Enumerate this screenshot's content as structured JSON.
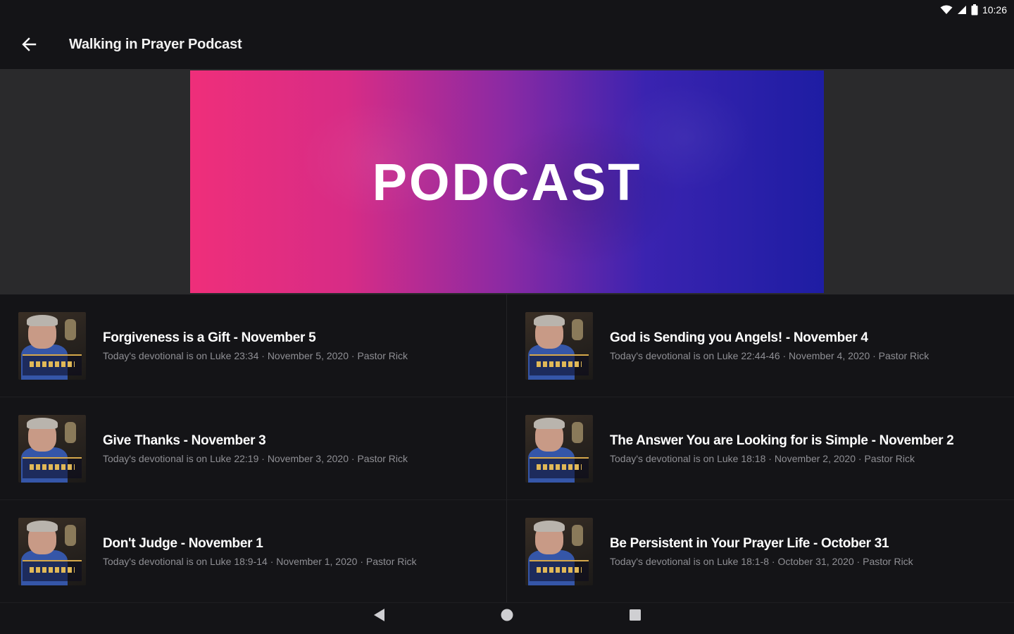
{
  "status_bar": {
    "time": "10:26",
    "icons": [
      "wifi-icon",
      "signal-icon",
      "battery-icon"
    ]
  },
  "app_bar": {
    "title": "Walking in Prayer Podcast",
    "back_icon": "arrow-left-icon"
  },
  "hero": {
    "text": "PODCAST",
    "colors": [
      "#ef2e7a",
      "#8a2aa4",
      "#1e1da3"
    ]
  },
  "episodes": [
    {
      "title": "Forgiveness is a Gift - November 5",
      "subtitle": "Today's devotional is on Luke 23:34 · November 5, 2020 · Pastor Rick"
    },
    {
      "title": "God is Sending you Angels! - November 4",
      "subtitle": "Today's devotional is on Luke 22:44-46 · November 4, 2020 · Pastor Rick"
    },
    {
      "title": "Give Thanks - November 3",
      "subtitle": "Today's devotional is on Luke 22:19 · November 3, 2020 · Pastor Rick"
    },
    {
      "title": "The Answer You are Looking for is Simple - November 2",
      "subtitle": "Today's devotional is on Luke 18:18 · November 2, 2020 · Pastor Rick"
    },
    {
      "title": "Don't Judge - November 1",
      "subtitle": "Today's devotional is on Luke 18:9-14 · November 1, 2020 · Pastor Rick"
    },
    {
      "title": "Be Persistent in Your Prayer Life - October 31",
      "subtitle": "Today's devotional is on Luke 18:1-8 · October 31, 2020 · Pastor Rick"
    }
  ],
  "nav_bar": {
    "icons": [
      "back-triangle-icon",
      "home-circle-icon",
      "recents-square-icon"
    ]
  }
}
